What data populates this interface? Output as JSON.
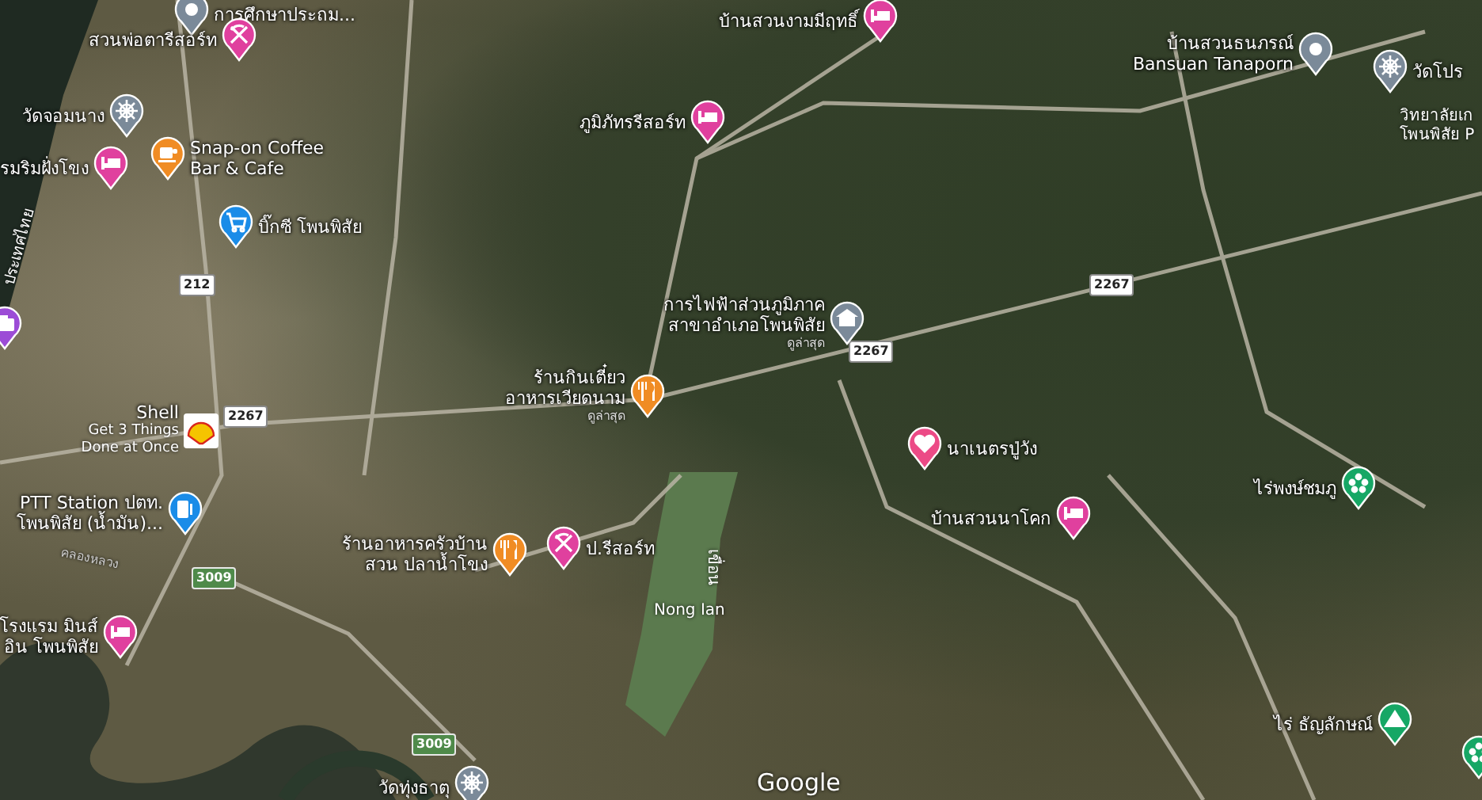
{
  "map": {
    "places": [
      {
        "kind": "generic",
        "color": "#7b8a99",
        "lines": [
          "การศึกษาประถม..."
        ]
      },
      {
        "kind": "hotel",
        "color": "#e0409e",
        "lines": [
          "บ้านสวนงามมีฤทธิ์"
        ]
      },
      {
        "kind": "resort",
        "color": "#e0409e",
        "lines": [
          "สวนพ่อตารีสอร์ท"
        ]
      },
      {
        "kind": "generic",
        "color": "#7b8a99",
        "lines": [
          "บ้านสวนธนภรณ์",
          "Bansuan Tanaporn"
        ]
      },
      {
        "kind": "temple",
        "color": "#7b8a99",
        "lines": [
          "วัดโปร"
        ]
      },
      {
        "kind": "temple",
        "color": "#7b8a99",
        "lines": [
          "วัดจอมนาง"
        ]
      },
      {
        "kind": "hotel",
        "color": "#e0409e",
        "lines": [
          "ภูมิภัทรรีสอร์ท"
        ]
      },
      {
        "kind": "hotel",
        "color": "#e0409e",
        "lines": [
          "รมริมฝั่งโขง"
        ]
      },
      {
        "kind": "cafe",
        "color": "#f08c24",
        "lines": [
          "Snap-on Coffee",
          "Bar & Cafe"
        ]
      },
      {
        "kind": "shop",
        "color": "#1a8ce8",
        "lines": [
          "บิ๊กซี โพนพิสัย"
        ]
      },
      {
        "kind": "building",
        "color": "#7b8a99",
        "lines": [
          "การไฟฟ้าส่วนภูมิภาค",
          "สาขาอำเภอโพนพิสัย"
        ],
        "note": "ดูล่าสุด"
      },
      {
        "kind": "camera",
        "color": "#9c4cd6"
      },
      {
        "kind": "restaurant",
        "color": "#f08c24",
        "lines": [
          "ร้านกินเตี๋ยว",
          "อาหารเวียดนาม"
        ],
        "note": "ดูล่าสุด"
      },
      {
        "kind": "shell",
        "color": "#f5c400",
        "lines": [
          "Shell"
        ],
        "sub": [
          "Get 3 Things",
          "Done at Once"
        ]
      },
      {
        "kind": "heart",
        "color": "#ec4a86",
        "lines": [
          "นาเนตรปู่วัง"
        ]
      },
      {
        "kind": "farm",
        "color": "#16a765",
        "lines": [
          "ไร่พงษ์ชมภู"
        ]
      },
      {
        "kind": "fuel",
        "color": "#1a8ce8",
        "lines": [
          "PTT Station ปตท.",
          "โพนพิสัย (น้ำมัน)..."
        ]
      },
      {
        "kind": "hotel",
        "color": "#e0409e",
        "lines": [
          "บ้านสวนนาโคก"
        ]
      },
      {
        "kind": "restaurant",
        "color": "#f08c24",
        "lines": [
          "ร้านอาหารครัวบ้าน",
          "สวน ปลาน้ำโขง"
        ]
      },
      {
        "kind": "resort",
        "color": "#e0409e",
        "lines": [
          "ป.รีสอร์ท"
        ]
      },
      {
        "kind": "hotel",
        "color": "#e0409e",
        "lines": [
          "โรงแรม มินส์",
          "อิน โพนพิสัย"
        ]
      },
      {
        "kind": "camp",
        "color": "#16a765",
        "lines": [
          "ไร่ ธัญลักษณ์"
        ]
      },
      {
        "kind": "farm",
        "color": "#16a765"
      },
      {
        "kind": "temple",
        "color": "#7b8a99",
        "lines": [
          "วัดทุ่งธาตุ"
        ]
      }
    ],
    "roads": [
      {
        "number": "212",
        "kind": "national"
      },
      {
        "number": "2267",
        "kind": "national"
      },
      {
        "number": "2267",
        "kind": "national"
      },
      {
        "number": "2267",
        "kind": "national"
      },
      {
        "number": "3009",
        "kind": "rural"
      },
      {
        "number": "3009",
        "kind": "rural"
      }
    ],
    "labels": [
      {
        "text": "ประเทศไทย",
        "kind": "region"
      },
      {
        "text": "คลองหลวง",
        "kind": "canal"
      },
      {
        "text": "เขื่อน",
        "kind": "dam"
      },
      {
        "text": "Nong Ian",
        "kind": "lake"
      },
      {
        "text": "วิทยาลัยเก\nโพนพิสัย P",
        "kind": "poi"
      }
    ],
    "attribution": "Google"
  }
}
